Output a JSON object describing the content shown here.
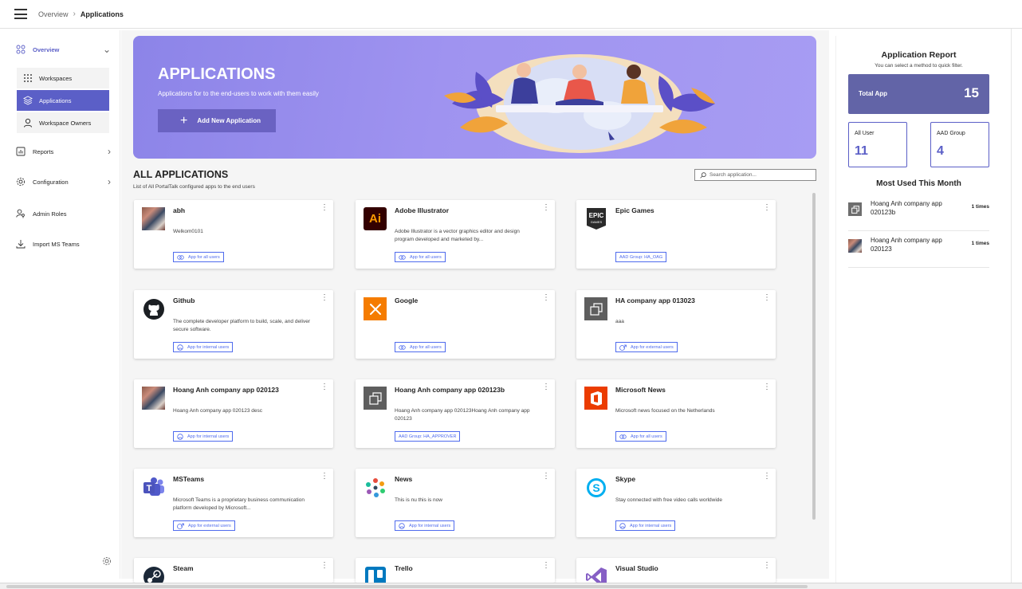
{
  "breadcrumb": {
    "parent": "Overview",
    "current": "Applications"
  },
  "sidebar": {
    "overview": "Overview",
    "sub_items": [
      {
        "label": "Workspaces"
      },
      {
        "label": "Applications",
        "active": true
      },
      {
        "label": "Workspace Owners"
      }
    ],
    "items": [
      {
        "label": "Reports"
      },
      {
        "label": "Configuration"
      },
      {
        "label": "Admin Roles"
      },
      {
        "label": "Import MS Teams"
      }
    ]
  },
  "banner": {
    "title": "APPLICATIONS",
    "subtitle": "Applications for to the end-users to work with them easily",
    "add_button": "Add New Application"
  },
  "apps_section": {
    "title": "ALL APPLICATIONS",
    "subtitle": "List of All PortalTalk configured apps to the end users",
    "search_placeholder": "Search application..."
  },
  "apps": [
    {
      "name": "abh",
      "desc": "Welkom0101",
      "tag": "App for all users",
      "icon": "photo-thumbnail"
    },
    {
      "name": "Adobe Illustrator",
      "desc": "Adobe Illustrator is a vector graphics editor and design program developed and marketed by...",
      "tag": "App for all users",
      "icon": "adobe-illustrator-logo"
    },
    {
      "name": "Epic Games",
      "desc": "",
      "tag": "AAD Group: HA_OAG",
      "icon": "epic-games-logo"
    },
    {
      "name": "Github",
      "desc": "The complete developer platform to build, scale, and deliver secure software.",
      "tag": "App for internal users",
      "icon": "github-logo"
    },
    {
      "name": "Google",
      "desc": "",
      "tag": "App for all users",
      "icon": "google-tools-logo"
    },
    {
      "name": "HA company app 013023",
      "desc": "aaa",
      "tag": "App for external users",
      "icon": "generic-app-icon"
    },
    {
      "name": "Hoang Anh company app 020123",
      "desc": "Hoang Anh company app 020123 desc",
      "tag": "App for internal users",
      "icon": "photo-thumbnail"
    },
    {
      "name": "Hoang Anh company app 020123b",
      "desc": "Hoang Anh company app 020123Hoang Anh company app 020123",
      "tag": "AAD Group: HA_APPROVER",
      "icon": "generic-app-icon"
    },
    {
      "name": "Microsoft News",
      "desc": "Microsoft news focused on the Netherlands",
      "tag": "App for all users",
      "icon": "office-logo"
    },
    {
      "name": "MSTeams",
      "desc": "Microsoft Teams is a proprietary business communication platform developed by Microsoft...",
      "tag": "App for external users",
      "icon": "teams-logo"
    },
    {
      "name": "News",
      "desc": "This is nu this is now",
      "tag": "App for internal users",
      "icon": "news-logo"
    },
    {
      "name": "Skype",
      "desc": "Stay connected with free video calls worldwide",
      "tag": "App for internal users",
      "icon": "skype-logo"
    },
    {
      "name": "Steam",
      "desc": "",
      "tag": "",
      "icon": "steam-logo"
    },
    {
      "name": "Trello",
      "desc": "",
      "tag": "",
      "icon": "trello-logo"
    },
    {
      "name": "Visual Studio",
      "desc": "",
      "tag": "",
      "icon": "visual-studio-logo"
    }
  ],
  "report": {
    "title": "Application Report",
    "subtitle": "You can select a method to quick filter.",
    "total_label": "Total App",
    "total_value": "15",
    "all_user_label": "All User",
    "all_user_value": "11",
    "aad_group_label": "AAD Group",
    "aad_group_value": "4",
    "most_used_title": "Most Used This Month",
    "most_used": [
      {
        "name": "Hoang Anh company app 020123b",
        "count": "1 times",
        "icon": "generic-app-icon"
      },
      {
        "name": "Hoang Anh company app 020123",
        "count": "1 times",
        "icon": "photo-thumbnail"
      }
    ]
  },
  "colors": {
    "accent": "#5b5fc7",
    "banner": "#9f93f0",
    "total_box": "#6264a7",
    "tag": "#4f6bed"
  }
}
